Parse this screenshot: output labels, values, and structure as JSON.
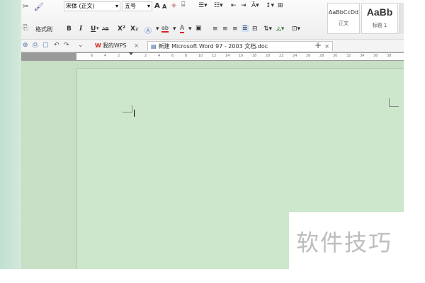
{
  "ribbon": {
    "format_painter_label": "格式刷",
    "font_name": "宋体 (正文)",
    "font_size": "五号",
    "grow_font": "A",
    "shrink_font": "A",
    "bold": "B",
    "italic": "I",
    "underline": "U",
    "strike": "AB",
    "superscript": "X²",
    "subscript": "X₂",
    "font_color_label": "A",
    "highlight_label": "ab",
    "char_shading_label": "A",
    "style_normal_sample": "AaBbCcDd",
    "style_normal_caption": "正文",
    "style_heading_sample": "AaBb",
    "style_heading_caption": "标题 1"
  },
  "tabs": {
    "wps_home": "我的WPS",
    "doc_title": "新建 Microsoft Word 97 - 2003 文档.doc",
    "close": "×",
    "new_tab": "+"
  },
  "ruler": {
    "ticks": [
      "6",
      "4",
      "2",
      "",
      "2",
      "4",
      "6",
      "8",
      "10",
      "12",
      "14",
      "16",
      "18",
      "20",
      "22",
      "24",
      "26",
      "28",
      "30",
      "32",
      "34",
      "36",
      "38"
    ]
  },
  "watermark": {
    "text": "软件技巧"
  },
  "colors": {
    "page_bg": "#cde7cd",
    "workspace_bg": "#c6dfc5",
    "wps_red": "#d9261c"
  }
}
